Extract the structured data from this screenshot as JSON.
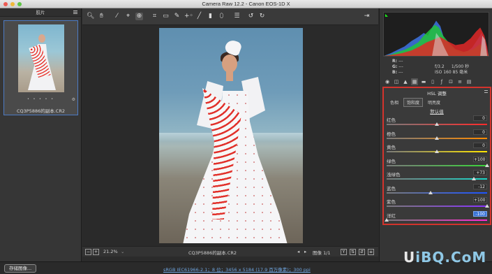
{
  "window": {
    "title": "Camera Raw 12.2  -  Canon EOS-1D X"
  },
  "filmstrip": {
    "header": "胶片",
    "thumb_rating": "• • • • •",
    "thumb_filename": "CQ3P5886的副本.CR2"
  },
  "toolbar": {
    "tools": [
      "zoom-icon",
      "hand-icon",
      "white-balance-icon",
      "color-sampler-icon",
      "targeted-adjustment-icon",
      "crop-icon",
      "straighten-icon",
      "spot-removal-icon",
      "red-eye-icon",
      "adjustment-brush-icon",
      "graduated-filter-icon",
      "radial-filter-icon",
      "rotate-ccw-icon",
      "rotate-cw-icon"
    ],
    "active_tool": "targeted-adjustment-icon"
  },
  "bottombar": {
    "zoom": "21.2%",
    "filename": "CQ3P5886的副本.CR2",
    "image_counter": "图像 1/1",
    "y_button": "Y"
  },
  "footer": {
    "save_button": "存储图像...",
    "workflow_link": "sRGB IEC61966-2.1；8 位；3456 x 5184 (17.9 百万像素)；300 ppi"
  },
  "watermark": {
    "part1": "U",
    "part2": "iBQ.CoM"
  },
  "info": {
    "r": "R:",
    "g": "G:",
    "b": "B:",
    "r_val": "---",
    "g_val": "---",
    "b_val": "---",
    "aperture": "f/3.2",
    "shutter": "1/500 秒",
    "iso": "ISO 160",
    "focal": "85 毫米"
  },
  "panel_tabs": [
    "basic-icon",
    "tone-curve-icon",
    "detail-icon",
    "hsl-icon",
    "split-toning-icon",
    "lens-icon",
    "fx-icon",
    "calibration-icon",
    "presets-icon",
    "snapshots-icon"
  ],
  "hsl": {
    "title": "HSL 调整",
    "subtabs": [
      "色相",
      "饱和度",
      "明亮度"
    ],
    "active_subtab": 1,
    "default_label": "默认值",
    "sliders": [
      {
        "label": "红色",
        "value": "0",
        "pos": 0.5,
        "grad": [
          "#7a7a7a",
          "#ff2a2a"
        ]
      },
      {
        "label": "橙色",
        "value": "0",
        "pos": 0.5,
        "grad": [
          "#7a7a7a",
          "#ff8a00"
        ]
      },
      {
        "label": "黄色",
        "value": "0",
        "pos": 0.5,
        "grad": [
          "#7a7a7a",
          "#ffe600"
        ]
      },
      {
        "label": "绿色",
        "value": "+100",
        "pos": 1.0,
        "grad": [
          "#7a7a7a",
          "#3bd43b"
        ]
      },
      {
        "label": "浅绿色",
        "value": "+73",
        "pos": 0.865,
        "grad": [
          "#7a7a7a",
          "#18d6c8"
        ]
      },
      {
        "label": "蓝色",
        "value": "-12",
        "pos": 0.44,
        "grad": [
          "#7a7a7a",
          "#1d54ff"
        ]
      },
      {
        "label": "紫色",
        "value": "+100",
        "pos": 1.0,
        "grad": [
          "#7a7a7a",
          "#8a34ff"
        ]
      },
      {
        "label": "洋红",
        "value": "-100",
        "pos": 0.0,
        "grad": [
          "#7a7a7a",
          "#ff2ad4"
        ],
        "selected": true
      }
    ]
  },
  "colors": {
    "accent_red": "#d4332c",
    "selection_blue": "#3a74d8",
    "link_blue": "#6fa5e0"
  }
}
